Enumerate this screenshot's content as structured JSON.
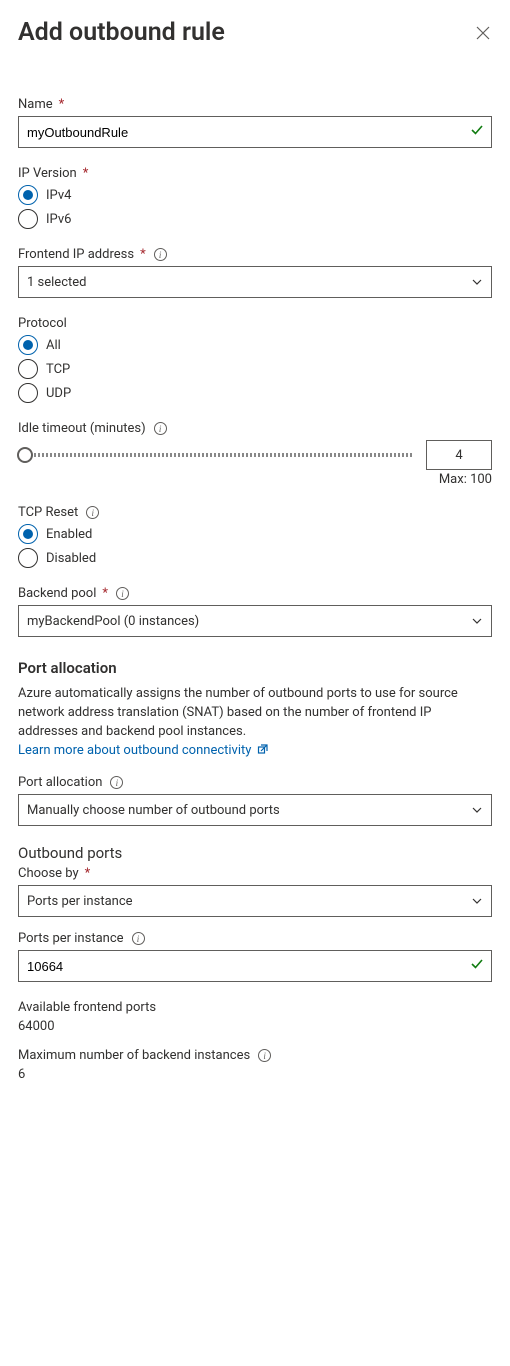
{
  "header": {
    "title": "Add outbound rule"
  },
  "name": {
    "label": "Name",
    "value": "myOutboundRule"
  },
  "ipVersion": {
    "label": "IP Version",
    "options": [
      "IPv4",
      "IPv6"
    ],
    "selected": "IPv4"
  },
  "frontend": {
    "label": "Frontend IP address",
    "value": "1 selected"
  },
  "protocol": {
    "label": "Protocol",
    "options": [
      "All",
      "TCP",
      "UDP"
    ],
    "selected": "All"
  },
  "idleTimeout": {
    "label": "Idle timeout (minutes)",
    "value": "4",
    "maxLabel": "Max: 100"
  },
  "tcpReset": {
    "label": "TCP Reset",
    "options": [
      "Enabled",
      "Disabled"
    ],
    "selected": "Enabled"
  },
  "backendPool": {
    "label": "Backend pool",
    "value": "myBackendPool (0 instances)"
  },
  "portAllocationSection": {
    "heading": "Port allocation",
    "desc": "Azure automatically assigns the number of outbound ports to use for source network address translation (SNAT) based on the number of frontend IP addresses and backend pool instances.",
    "link": "Learn more about outbound connectivity"
  },
  "portAllocation": {
    "label": "Port allocation",
    "value": "Manually choose number of outbound ports"
  },
  "outboundPorts": {
    "heading": "Outbound ports"
  },
  "chooseBy": {
    "label": "Choose by",
    "value": "Ports per instance"
  },
  "portsPerInstance": {
    "label": "Ports per instance",
    "value": "10664"
  },
  "availableFrontendPorts": {
    "label": "Available frontend ports",
    "value": "64000"
  },
  "maxBackendInstances": {
    "label": "Maximum number of backend instances",
    "value": "6"
  }
}
